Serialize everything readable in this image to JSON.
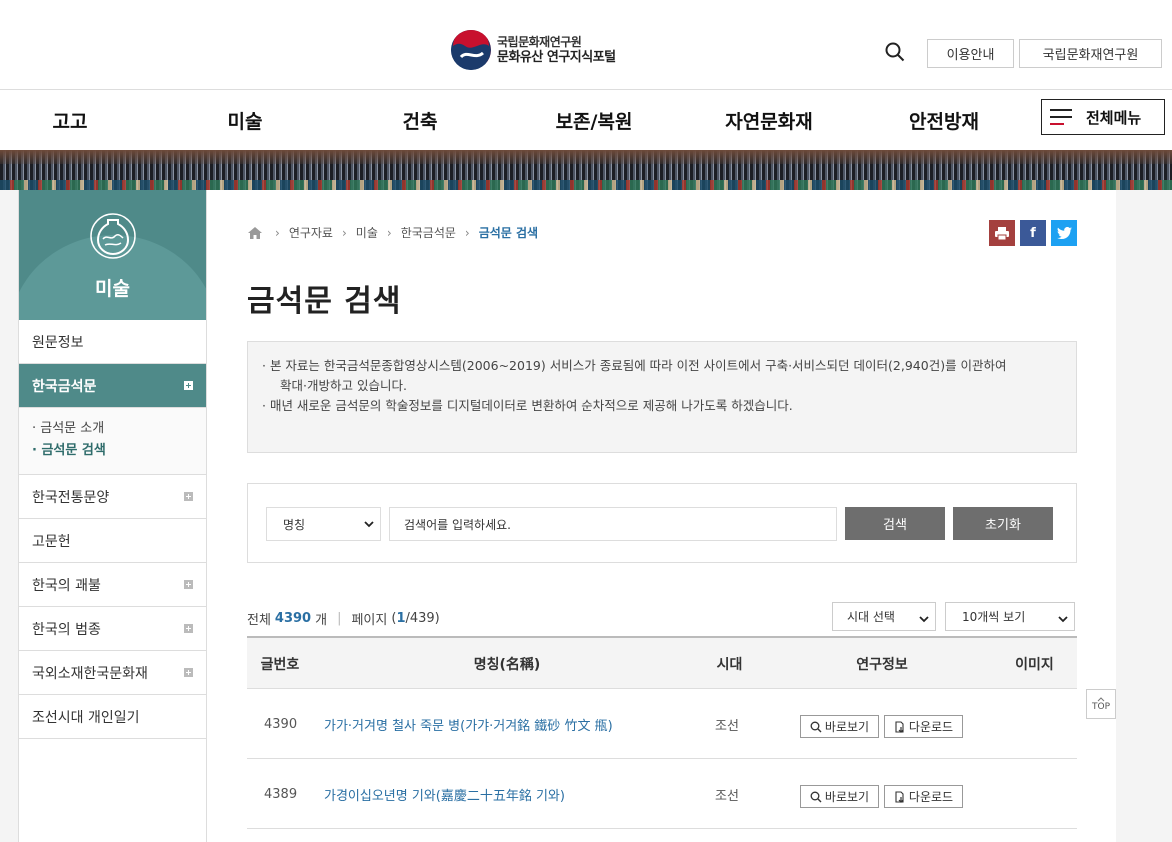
{
  "header": {
    "logo_line1": "국립문화재연구원",
    "logo_line2": "문화유산 연구지식포털",
    "util_guide": "이용안내",
    "util_nrich": "국립문화재연구원"
  },
  "gnb": {
    "items": [
      "고고",
      "미술",
      "건축",
      "보존/복원",
      "자연문화재",
      "안전방재"
    ],
    "allmenu": "전체메뉴"
  },
  "sidebar": {
    "title": "미술",
    "items": [
      {
        "label": "원문정보",
        "has_plus": false
      },
      {
        "label": "한국금석문",
        "has_plus": true,
        "active": true
      },
      {
        "label": "한국전통문양",
        "has_plus": true
      },
      {
        "label": "고문헌",
        "has_plus": false
      },
      {
        "label": "한국의 괘불",
        "has_plus": true
      },
      {
        "label": "한국의 범종",
        "has_plus": true
      },
      {
        "label": "국외소재한국문화재",
        "has_plus": true
      },
      {
        "label": "조선시대 개인일기",
        "has_plus": false
      }
    ],
    "sub_items": [
      "· 금석문 소개",
      "· 금석문 검색"
    ]
  },
  "breadcrumb": [
    "연구자료",
    "미술",
    "한국금석문",
    "금석문 검색"
  ],
  "share": {
    "print_icon": "print-icon",
    "facebook": "f",
    "twitter_icon": "twitter-icon"
  },
  "page_title": "금석문 검색",
  "notice": {
    "line1": "· 본 자료는 한국금석문종합영상시스템(2006~2019) 서비스가 종료됨에 따라 이전 사이트에서 구축·서비스되던 데이터(2,940건)를 이관하여",
    "line2": "확대·개방하고 있습니다.",
    "line3": "· 매년 새로운 금석문의 학술정보를 디지털데이터로 변환하여 순차적으로 제공해 나가도록 하겠습니다."
  },
  "search": {
    "field_select": "명칭",
    "placeholder": "검색어를 입력하세요.",
    "search_btn": "검색",
    "reset_btn": "초기화"
  },
  "result": {
    "total_label": "전체",
    "total": "4390",
    "unit": "개",
    "page_label": "페이지",
    "page_open": "(",
    "page_current": "1",
    "page_total": "/439)",
    "era_select": "시대 선택",
    "per_page_select": "10개씩 보기"
  },
  "table": {
    "headers": [
      "글번호",
      "명칭(名稱)",
      "시대",
      "연구정보",
      "이미지"
    ],
    "rows": [
      {
        "no": "4390",
        "name": "가가·거겨명 철사 죽문 병(가갸·거겨銘 鐵砂 竹文 甁)",
        "era": "조선",
        "view": "바로보기",
        "download": "다운로드"
      },
      {
        "no": "4389",
        "name": "가경이십오년명 기와(嘉慶二十五年銘 기와)",
        "era": "조선",
        "view": "바로보기",
        "download": "다운로드"
      }
    ]
  },
  "top_button": "TOP"
}
